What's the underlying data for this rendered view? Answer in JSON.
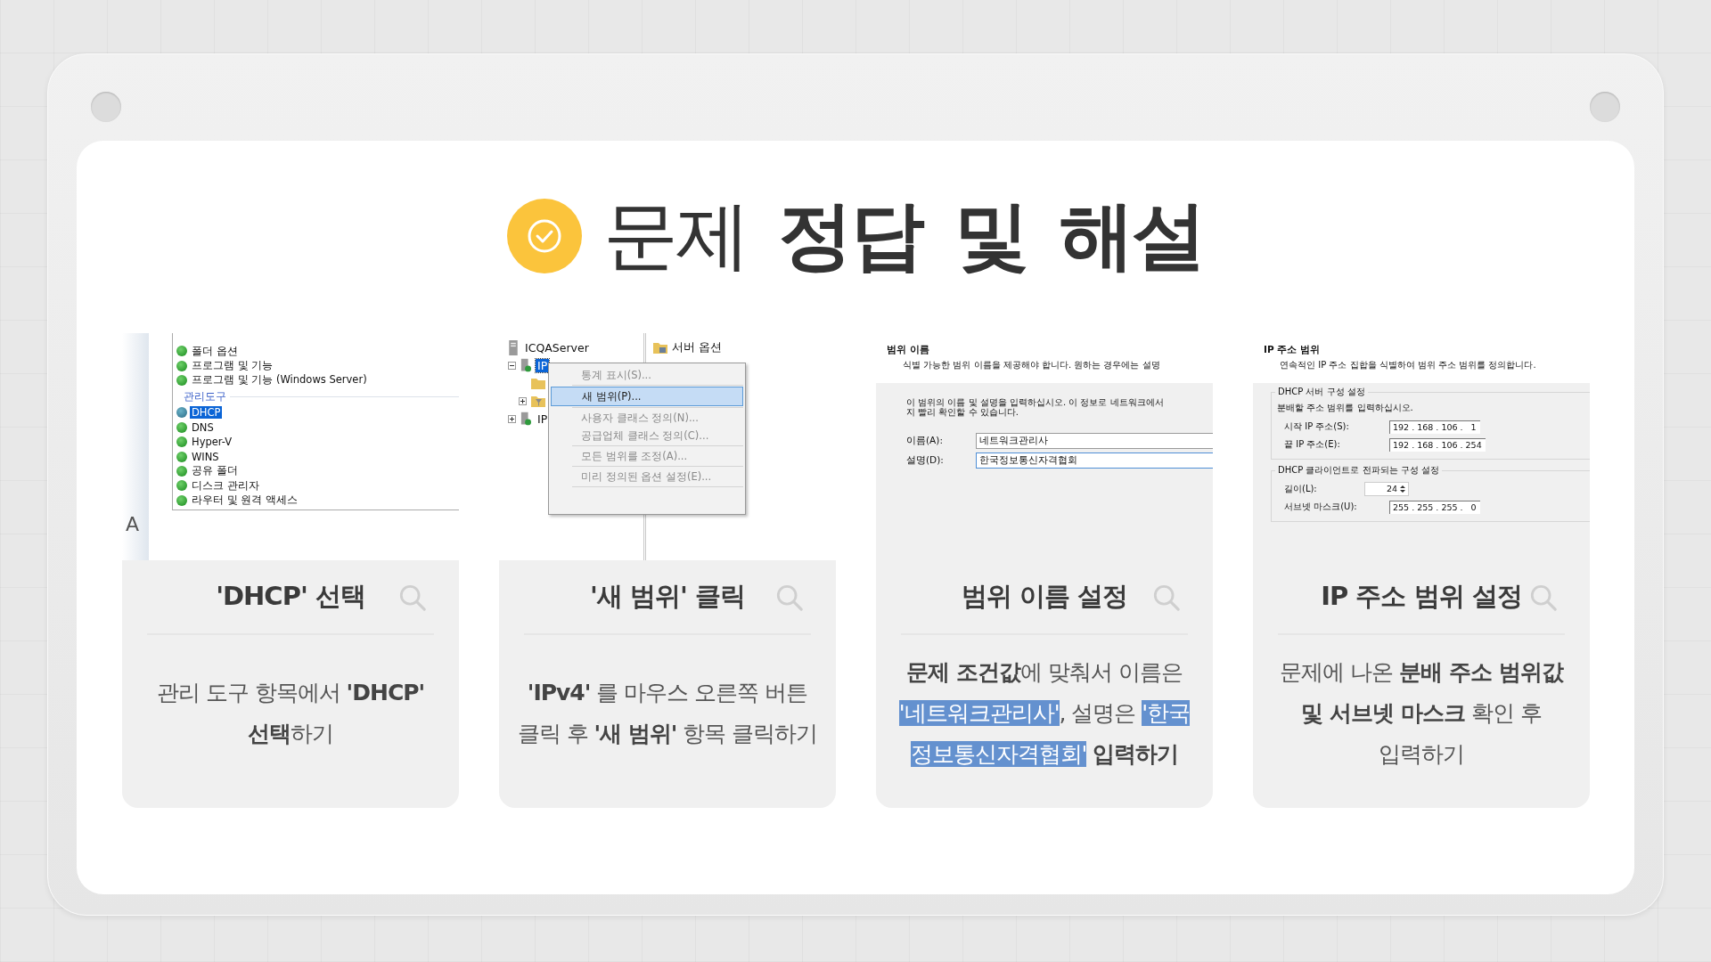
{
  "title": "문제 **정답 및 해설**",
  "cards": [
    {
      "heading": "'DHCP' 선택",
      "description": [
        [
          {
            "text": "관리 도구 항목에서 **'DHCP'**",
            "highlighted": false
          }
        ],
        [
          {
            "text": "**선택**하기",
            "highlighted": false
          }
        ]
      ],
      "shot": {
        "kind": "features",
        "edge_text": "A",
        "items": [
          {
            "label": "폴더 옵션",
            "selected": false
          },
          {
            "label": "프로그램 및 기능",
            "selected": false
          },
          {
            "label": "프로그램 및 기능 (Windows Server)",
            "selected": false
          }
        ],
        "section": "관리도구",
        "tools": [
          {
            "label": "DHCP",
            "selected": true
          },
          {
            "label": "DNS",
            "selected": false
          },
          {
            "label": "Hyper-V",
            "selected": false
          },
          {
            "label": "WINS",
            "selected": false
          },
          {
            "label": "공유 폴더",
            "selected": false
          },
          {
            "label": "디스크 관리자",
            "selected": false
          },
          {
            "label": "라우터 및 원격 액세스",
            "selected": false
          }
        ]
      }
    },
    {
      "heading": "'새 범위' 클릭",
      "description": [
        [
          {
            "text": "**'IPv4'** 를 마우스 오른쪽 버튼",
            "highlighted": false
          }
        ],
        [
          {
            "text": "클릭 후 **'새 범위'** 항목 클릭하기",
            "highlighted": false
          }
        ]
      ],
      "shot": {
        "kind": "menu",
        "server": "ICQAServer",
        "nodes": [
          {
            "label": "IP",
            "selected": true,
            "expanded": true
          },
          {
            "label": "IP",
            "selected": false,
            "expanded": false
          }
        ],
        "pane_item": "서버 옵션",
        "menu": [
          {
            "items": [
              {
                "label": "통계 표시(S)...",
                "selected": false,
                "disabled": true
              }
            ]
          },
          {
            "items": [
              {
                "label": "새 범위(P)...",
                "selected": true,
                "disabled": false
              }
            ]
          },
          {
            "items": [
              {
                "label": "사용자 클래스 정의(N)...",
                "selected": false,
                "disabled": true
              },
              {
                "label": "공급업체 클래스 정의(C)...",
                "selected": false,
                "disabled": true
              }
            ]
          },
          {
            "items": [
              {
                "label": "모든 범위를 조정(A)...",
                "selected": false,
                "disabled": true
              }
            ]
          },
          {
            "items": [
              {
                "label": "미리 정의된 옵션 설정(E)...",
                "selected": false,
                "disabled": true
              }
            ]
          }
        ]
      }
    },
    {
      "heading": "범위 이름 설정",
      "description": [
        [
          {
            "text": "**문제 조건값**에 맞춰서 이름은",
            "highlighted": false
          }
        ],
        [
          {
            "text": "'네트워크관리사'",
            "highlighted": true
          },
          {
            "text": ", 설명은 ",
            "highlighted": false
          },
          {
            "text": "'한국",
            "highlighted": true
          }
        ],
        [
          {
            "text": "정보통신자격협회'",
            "highlighted": true
          },
          {
            "text": " **입력하기**",
            "highlighted": false
          }
        ]
      ],
      "shot": {
        "kind": "scope_name",
        "header": "범위 이름",
        "subheader": "식별 가능한 범위 이름을 제공해야 합니다. 원하는 경우에는 설명",
        "intro": [
          "이 범위의 이름 및 설명을 입력하십시오. 이 정보로 네트워크에서",
          "지 빨리 확인할 수 있습니다."
        ],
        "fields": [
          {
            "label": "이름(A):",
            "value": "네트워크관리사",
            "focused": false
          },
          {
            "label": "설명(D):",
            "value": "한국정보통신자격협회",
            "focused": true
          }
        ]
      }
    },
    {
      "heading": "IP 주소 범위 설정",
      "description": [
        [
          {
            "text": "문제에 나온 **분배 주소 범위값**",
            "highlighted": false
          }
        ],
        [
          {
            "text": "**및 서브넷 마스크** 확인 후",
            "highlighted": false
          }
        ],
        [
          {
            "text": "입력하기",
            "highlighted": false
          }
        ]
      ],
      "shot": {
        "kind": "ip_range",
        "header": "IP 주소 범위",
        "subheader": "연속적인 IP 주소 집합을 식별하여 범위 주소 범위를 정의합니다.",
        "groups": [
          {
            "legend": "DHCP 서버 구성 설정",
            "hint": "분배할 주소 범위를 입력하십시오.",
            "fields": [
              {
                "kind": "ip",
                "label": "시작 IP 주소(S):",
                "value": "192 . 168 . 106 .   1"
              },
              {
                "kind": "ip",
                "label": "끝 IP 주소(E):",
                "value": "192 . 168 . 106 . 254"
              }
            ]
          },
          {
            "legend": "DHCP 클라이언트로 전파되는 구성 설정",
            "fields": [
              {
                "kind": "spin",
                "label": "길이(L):",
                "value": "24"
              },
              {
                "kind": "ip",
                "label": "서브넷 마스크(U):",
                "value": "255 . 255 . 255 .   0"
              }
            ]
          }
        ]
      }
    }
  ]
}
